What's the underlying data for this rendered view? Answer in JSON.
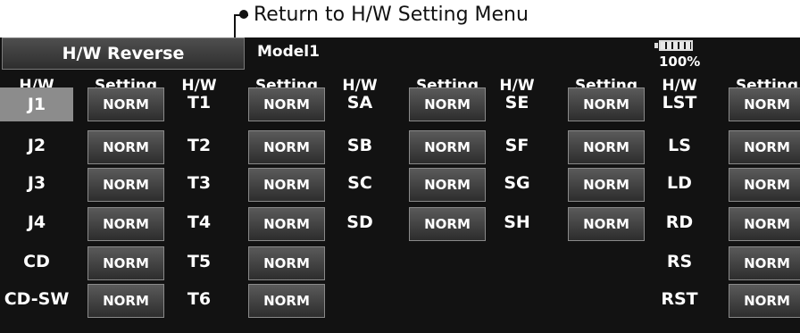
{
  "callout": {
    "text": "Return to H/W Setting Menu"
  },
  "header": {
    "title": "H/W Reverse",
    "model": "Model1",
    "battery_pct": "100%",
    "battery_level": 1.0
  },
  "columns": [
    {
      "hw_label": "H/W",
      "setting_label": "Setting",
      "rows": [
        {
          "hw": "J1",
          "setting": "NORM"
        },
        {
          "hw": "J2",
          "setting": "NORM"
        },
        {
          "hw": "J3",
          "setting": "NORM"
        },
        {
          "hw": "J4",
          "setting": "NORM"
        },
        {
          "hw": "CD",
          "setting": "NORM"
        },
        {
          "hw": "CD-SW",
          "setting": "NORM"
        }
      ]
    },
    {
      "hw_label": "H/W",
      "setting_label": "Setting",
      "rows": [
        {
          "hw": "T1",
          "setting": "NORM"
        },
        {
          "hw": "T2",
          "setting": "NORM"
        },
        {
          "hw": "T3",
          "setting": "NORM"
        },
        {
          "hw": "T4",
          "setting": "NORM"
        },
        {
          "hw": "T5",
          "setting": "NORM"
        },
        {
          "hw": "T6",
          "setting": "NORM"
        }
      ]
    },
    {
      "hw_label": "H/W",
      "setting_label": "Setting",
      "rows": [
        {
          "hw": "SA",
          "setting": "NORM"
        },
        {
          "hw": "SB",
          "setting": "NORM"
        },
        {
          "hw": "SC",
          "setting": "NORM"
        },
        {
          "hw": "SD",
          "setting": "NORM"
        }
      ]
    },
    {
      "hw_label": "H/W",
      "setting_label": "Setting",
      "rows": [
        {
          "hw": "SE",
          "setting": "NORM"
        },
        {
          "hw": "SF",
          "setting": "NORM"
        },
        {
          "hw": "SG",
          "setting": "NORM"
        },
        {
          "hw": "SH",
          "setting": "NORM"
        }
      ]
    },
    {
      "hw_label": "H/W",
      "setting_label": "Setting",
      "rows": [
        {
          "hw": "LST",
          "setting": "NORM"
        },
        {
          "hw": "LS",
          "setting": "NORM"
        },
        {
          "hw": "LD",
          "setting": "NORM"
        },
        {
          "hw": "RD",
          "setting": "NORM"
        },
        {
          "hw": "RS",
          "setting": "NORM"
        },
        {
          "hw": "RST",
          "setting": "NORM"
        }
      ]
    }
  ],
  "selected": "J1",
  "colors": {
    "background": "#121212",
    "selected_cell": "#8c8c8c",
    "button_border": "#8a8a8a"
  }
}
